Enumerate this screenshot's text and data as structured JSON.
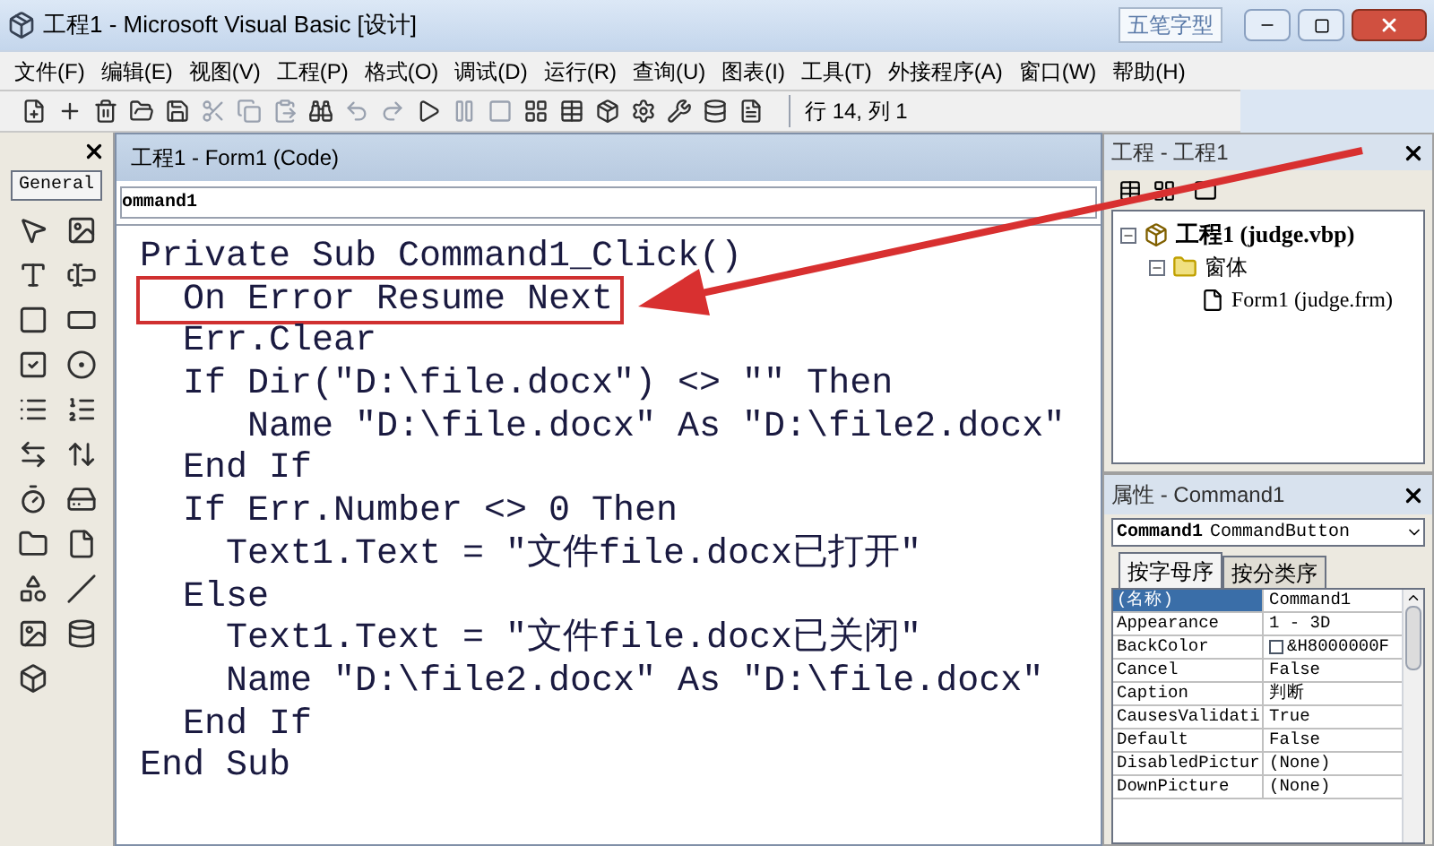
{
  "window": {
    "title": "工程1 - Microsoft Visual Basic [设计]",
    "ime_badge": "五笔字型"
  },
  "menu": [
    "文件(F)",
    "编辑(E)",
    "视图(V)",
    "工程(P)",
    "格式(O)",
    "调试(D)",
    "运行(R)",
    "查询(U)",
    "图表(I)",
    "工具(T)",
    "外接程序(A)",
    "窗口(W)",
    "帮助(H)"
  ],
  "toolbar": {
    "position": "行 14, 列 1"
  },
  "toolbox": {
    "tab": "General"
  },
  "code_window": {
    "title": "工程1 - Form1 (Code)",
    "object": "ommand1",
    "lines": [
      {
        "text": "Private Sub Command1_Click()",
        "highlighted": false
      },
      {
        "text": "  On Error Resume Next",
        "highlighted": true
      },
      {
        "text": "  Err.Clear",
        "highlighted": false
      },
      {
        "text": "  If Dir(\"D:\\file.docx\") <> \"\" Then",
        "highlighted": false
      },
      {
        "text": "     Name \"D:\\file.docx\" As \"D:\\file2.docx\"",
        "highlighted": false
      },
      {
        "text": "  End If",
        "highlighted": false
      },
      {
        "text": "  If Err.Number <> 0 Then",
        "highlighted": false
      },
      {
        "text": "    Text1.Text = \"文件file.docx已打开\"",
        "highlighted": false
      },
      {
        "text": "  Else",
        "highlighted": false
      },
      {
        "text": "    Text1.Text = \"文件file.docx已关闭\"",
        "highlighted": false
      },
      {
        "text": "    Name \"D:\\file2.docx\" As \"D:\\file.docx\"",
        "highlighted": false
      },
      {
        "text": "  End If",
        "highlighted": false
      },
      {
        "text": "End Sub",
        "highlighted": false
      }
    ]
  },
  "project": {
    "title": "工程 - 工程1",
    "tree": [
      {
        "label": "工程1 (judge.vbp)",
        "expanded": true,
        "kind": "project",
        "children": [
          {
            "label": "窗体",
            "expanded": true,
            "kind": "folder",
            "children": [
              {
                "label": "Form1 (judge.frm)",
                "kind": "form"
              }
            ]
          }
        ]
      }
    ]
  },
  "properties": {
    "title": "属性 - Command1",
    "object_name": "Command1",
    "object_type": "CommandButton",
    "tabs": [
      {
        "label": "按字母序",
        "selected": true
      },
      {
        "label": "按分类序",
        "selected": false
      }
    ],
    "rows": [
      {
        "name": "(名称)",
        "value": "Command1",
        "selected": true
      },
      {
        "name": "Appearance",
        "value": "1 - 3D",
        "selected": false
      },
      {
        "name": "BackColor",
        "value": "&H8000000F",
        "selected": false,
        "kind": "color"
      },
      {
        "name": "Cancel",
        "value": "False",
        "selected": false
      },
      {
        "name": "Caption",
        "value": "判断",
        "selected": false
      },
      {
        "name": "CausesValidati",
        "value": "True",
        "selected": false
      },
      {
        "name": "Default",
        "value": "False",
        "selected": false
      },
      {
        "name": "DisabledPictur",
        "value": "(None)",
        "selected": false
      },
      {
        "name": "DownPicture",
        "value": "(None)",
        "selected": false
      }
    ]
  }
}
